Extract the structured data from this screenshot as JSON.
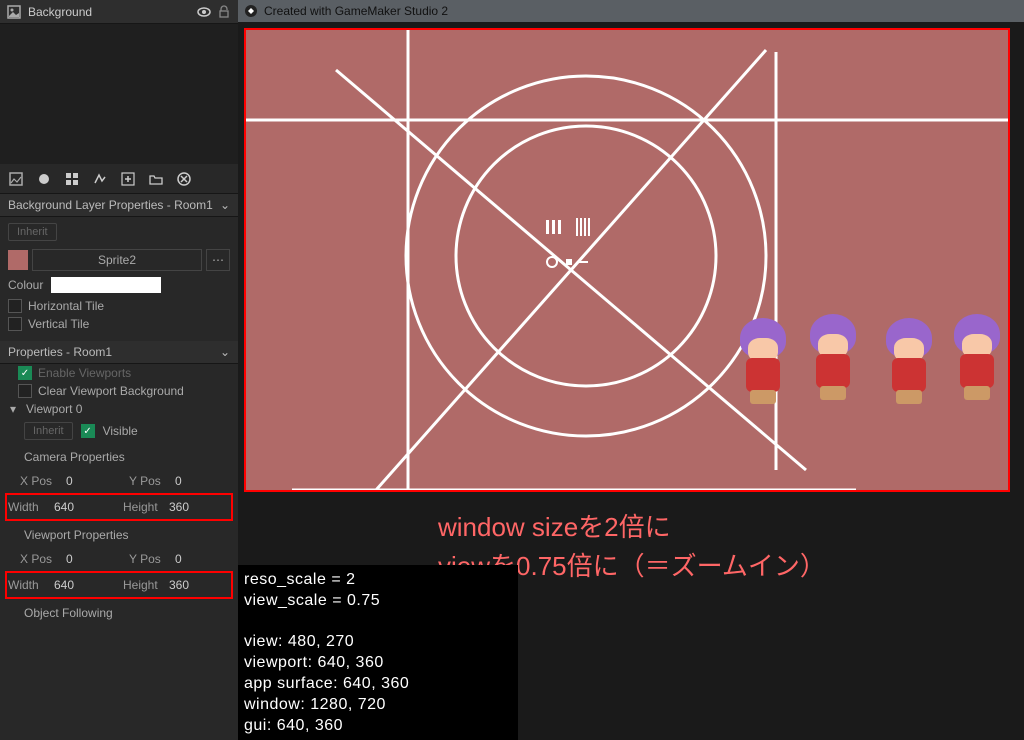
{
  "left": {
    "header_title": "Background",
    "section1_title": "Background Layer Properties - Room1",
    "inherit_label": "Inherit",
    "sprite_label": "Sprite2",
    "colour_label": "Colour",
    "horizontal_tile": "Horizontal Tile",
    "vertical_tile": "Vertical Tile",
    "section2_title": "Properties - Room1",
    "enable_viewports": "Enable Viewports",
    "clear_viewport_bg": "Clear Viewport Background",
    "viewport0": "Viewport 0",
    "visible_label": "Visible",
    "camera_props": "Camera Properties",
    "viewport_props": "Viewport Properties",
    "object_following": "Object Following",
    "xpos": "X Pos",
    "ypos": "Y Pos",
    "width": "Width",
    "height": "Height",
    "camera": {
      "x": "0",
      "y": "0",
      "w": "640",
      "h": "360"
    },
    "viewport": {
      "x": "0",
      "y": "0",
      "w": "640",
      "h": "360"
    }
  },
  "right": {
    "window_title": "Created with GameMaker Studio 2",
    "caption_line1": "window sizeを2倍に",
    "caption_line2": "viewを0.75倍に（＝ズームイン）"
  },
  "debug": {
    "line1": "reso_scale = 2",
    "line2": "view_scale = 0.75",
    "line3": "view: 480, 270",
    "line4": "viewport: 640, 360",
    "line5": "app surface: 640, 360",
    "line6": "window: 1280, 720",
    "line7": "gui: 640, 360"
  },
  "colors": {
    "canvas_bg": "#b06a68",
    "highlight": "#ff0000",
    "caption": "#ff6666"
  },
  "icons": {
    "image": "image-icon",
    "eye": "eye-icon",
    "lock": "lock-icon",
    "close": "close-icon"
  }
}
